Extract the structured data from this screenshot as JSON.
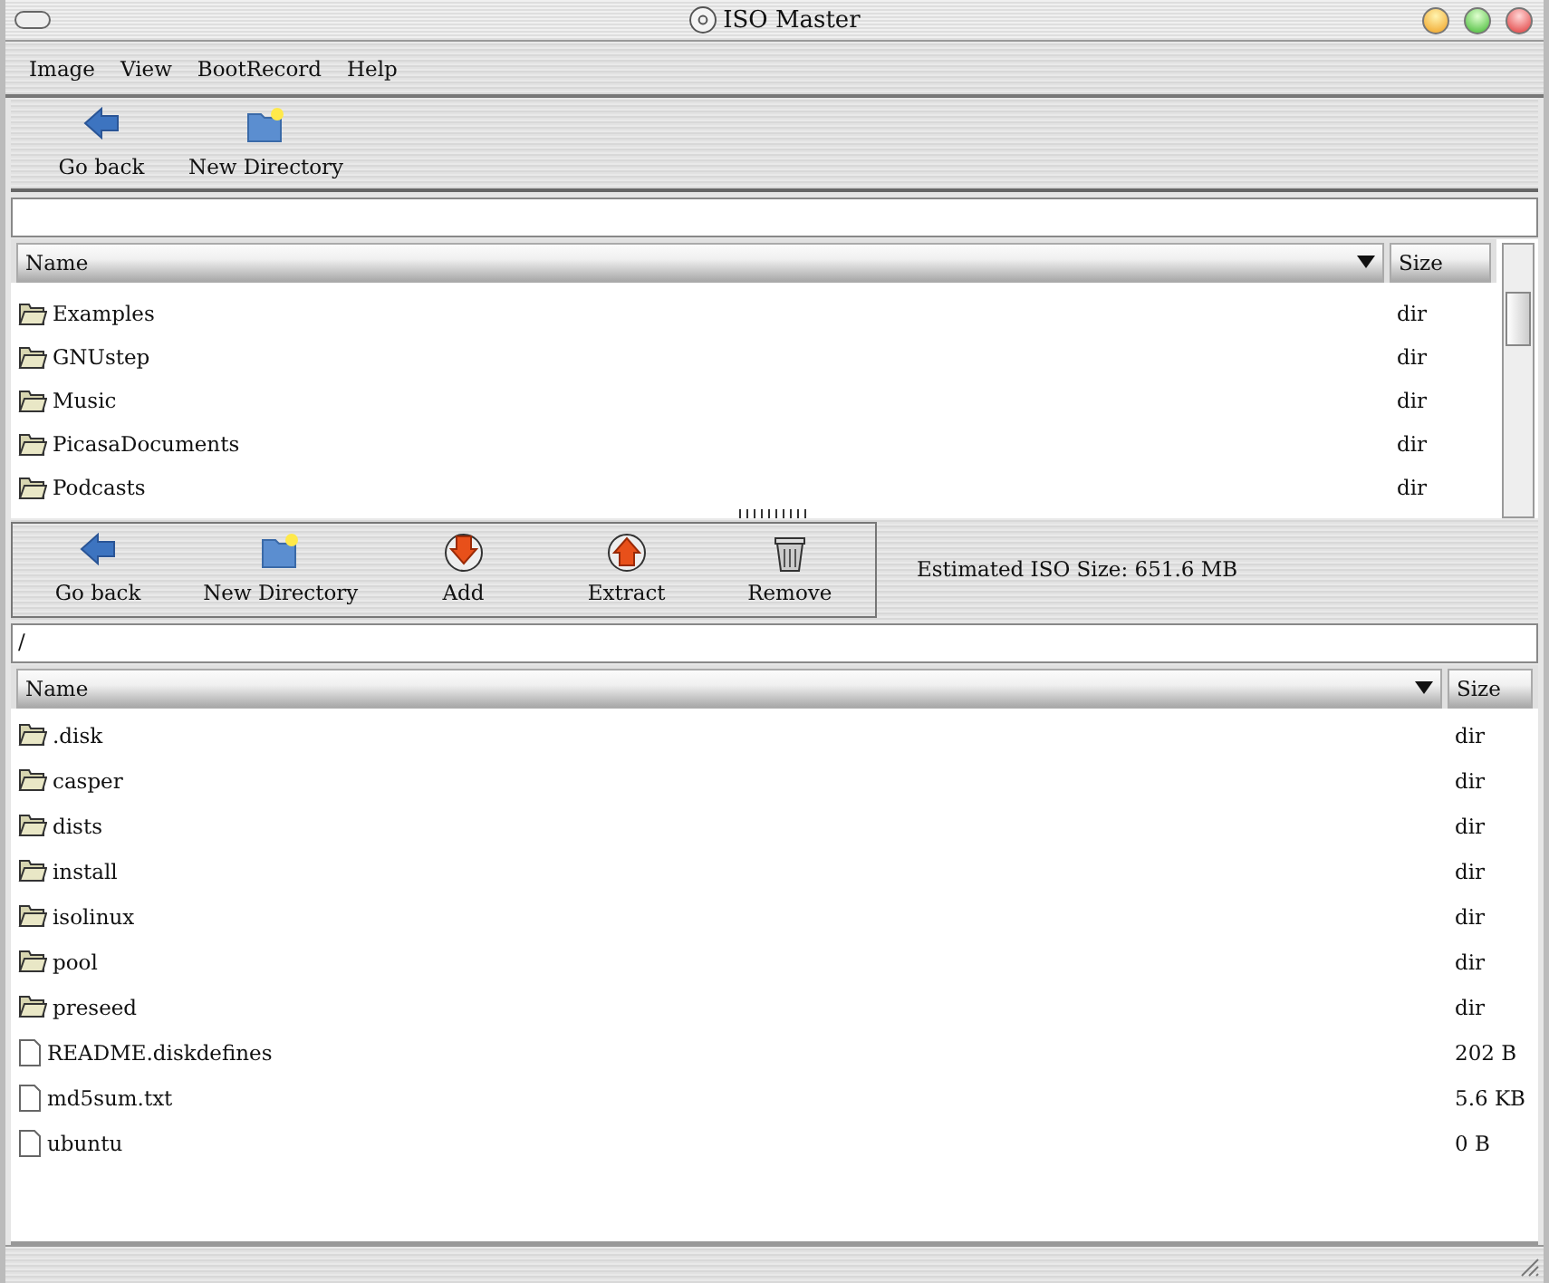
{
  "window": {
    "title": "ISO Master"
  },
  "menu": [
    "Image",
    "View",
    "BootRecord",
    "Help"
  ],
  "fs_toolbar": {
    "buttons": [
      {
        "label": "Go back",
        "kind": "back"
      },
      {
        "label": "New Directory",
        "kind": "new-dir"
      }
    ]
  },
  "fs_browser": {
    "columns": [
      "Name",
      "Size"
    ],
    "rows": [
      {
        "name": "Examples",
        "size": "dir",
        "kind": "folder"
      },
      {
        "name": "GNUstep",
        "size": "dir",
        "kind": "folder"
      },
      {
        "name": "Music",
        "size": "dir",
        "kind": "folder"
      },
      {
        "name": "PicasaDocuments",
        "size": "dir",
        "kind": "folder"
      },
      {
        "name": "Podcasts",
        "size": "dir",
        "kind": "folder"
      }
    ]
  },
  "iso_toolbar": {
    "buttons": [
      {
        "label": "Go back",
        "kind": "back"
      },
      {
        "label": "New Directory",
        "kind": "new-dir"
      },
      {
        "label": "Add",
        "kind": "add"
      },
      {
        "label": "Extract",
        "kind": "extract"
      },
      {
        "label": "Remove",
        "kind": "remove"
      }
    ],
    "estimate": "Estimated ISO Size: 651.6 MB"
  },
  "iso_browser": {
    "path": "/",
    "columns": [
      "Name",
      "Size"
    ],
    "rows": [
      {
        "name": ".disk",
        "size": "dir",
        "kind": "folder"
      },
      {
        "name": "casper",
        "size": "dir",
        "kind": "folder"
      },
      {
        "name": "dists",
        "size": "dir",
        "kind": "folder"
      },
      {
        "name": "install",
        "size": "dir",
        "kind": "folder"
      },
      {
        "name": "isolinux",
        "size": "dir",
        "kind": "folder"
      },
      {
        "name": "pool",
        "size": "dir",
        "kind": "folder"
      },
      {
        "name": "preseed",
        "size": "dir",
        "kind": "folder"
      },
      {
        "name": "README.diskdefines",
        "size": "202 B",
        "kind": "file"
      },
      {
        "name": "md5sum.txt",
        "size": "5.6 KB",
        "kind": "file"
      },
      {
        "name": "ubuntu",
        "size": "0 B",
        "kind": "file"
      }
    ]
  }
}
